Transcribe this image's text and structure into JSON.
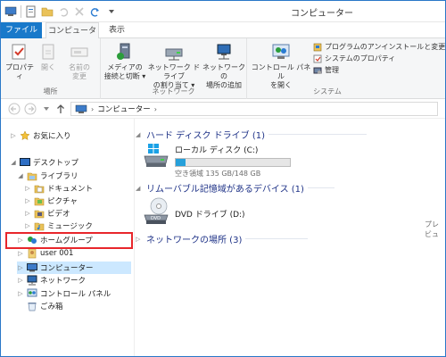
{
  "window": {
    "title": "コンピューター"
  },
  "tabs": {
    "file": "ファイル",
    "computer": "コンピューター",
    "view": "表示"
  },
  "ribbon": {
    "group_location": {
      "label": "場所",
      "properties": "プロパティ",
      "open": "開く",
      "rename_line1": "名前の",
      "rename_line2": "変更"
    },
    "group_network": {
      "label": "ネットワーク",
      "media_line1": "メディアの",
      "media_line2": "接続と切断 ▾",
      "mapdrive_line1": "ネットワーク ドライブ",
      "mapdrive_line2": "の割り当て ▾",
      "addloc_line1": "ネットワークの",
      "addloc_line2": "場所の追加"
    },
    "group_system": {
      "label": "システム",
      "control_line1": "コントロール パネル",
      "control_line2": "を開く",
      "uninstall": "プログラムのアンインストールと変更",
      "sysprops": "システムのプロパティ",
      "manage": "管理"
    }
  },
  "address": {
    "path": "コンピューター"
  },
  "navpane": {
    "favorites": "お気に入り",
    "desktop": "デスクトップ",
    "libraries": "ライブラリ",
    "documents": "ドキュメント",
    "pictures": "ピクチャ",
    "videos": "ビデオ",
    "music": "ミュージック",
    "homegroup": "ホームグループ",
    "user": "user 001",
    "computer": "コンピューター",
    "network": "ネットワーク",
    "control_panel": "コントロール パネル",
    "recycle": "ごみ箱"
  },
  "content": {
    "hdd_header": "ハード ディスク ドライブ (1)",
    "local_disk_name": "ローカル ディスク (C:)",
    "local_disk_free": "空き領域 135 GB/148 GB",
    "local_disk_used_fraction": 0.088,
    "removable_header": "リムーバブル記憶域があるデバイス (1)",
    "dvd_name": "DVD ドライブ (D:)",
    "netloc_header": "ネットワークの場所 (3)"
  },
  "preview_stub": "プレビュ",
  "colors": {
    "accent": "#1979ca",
    "highlight": "#e8262b",
    "header_text": "#1e3287"
  }
}
